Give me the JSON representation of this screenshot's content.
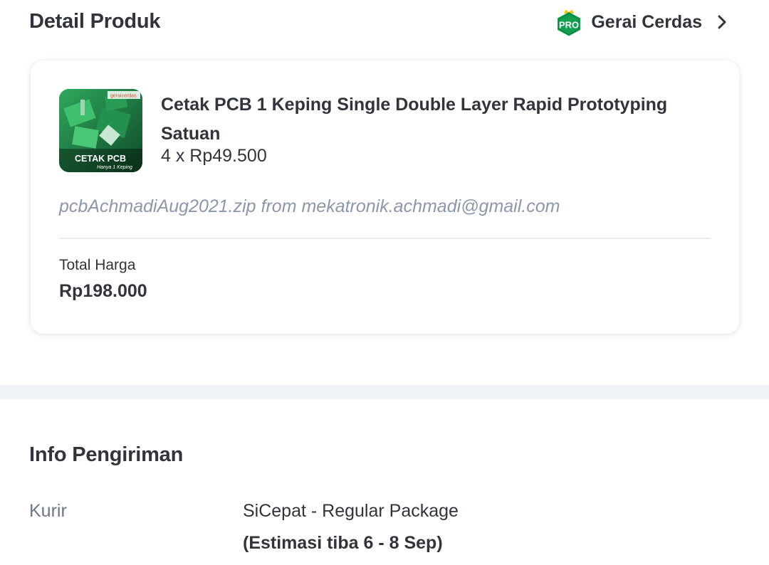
{
  "product_section": {
    "title": "Detail Produk",
    "seller": {
      "badge_text": "PRO",
      "name": "Gerai Cerdas",
      "chevron_icon": "chevron-right-icon"
    },
    "item": {
      "thumbnail": {
        "overlay_title": "CETAK PCB",
        "overlay_subtitle": "Hanya 1 Keping",
        "brand_mark": "geraicerdas"
      },
      "name": "Cetak PCB 1 Keping Single Double Layer Rapid Prototyping Satuan",
      "qty_price": "4 x Rp49.500",
      "note": "pcbAchmadiAug2021.zip from mekatronik.achmadi@gmail.com"
    },
    "total": {
      "label": "Total Harga",
      "value": "Rp198.000"
    }
  },
  "shipping_section": {
    "title": "Info Pengiriman",
    "courier_label": "Kurir",
    "courier_value": "SiCepat - Regular Package",
    "estimate": "(Estimasi tiba 6 - 8 Sep)"
  },
  "colors": {
    "text": "#31353b",
    "muted": "#6d7588",
    "note": "#8d96aa",
    "pro_green": "#12a04f",
    "crown": "#ffc400",
    "separator": "#f0f3f7"
  }
}
